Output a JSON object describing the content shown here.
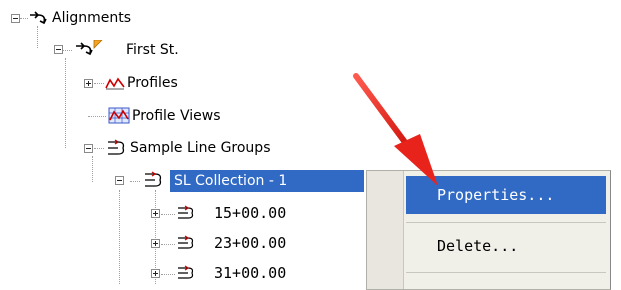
{
  "tree": {
    "items": [
      {
        "label": "Alignments",
        "icon": "alignment-icon"
      },
      {
        "label": "First St.",
        "icon": "alignment-flag-icon"
      },
      {
        "label": "Profiles",
        "icon": "profiles-icon"
      },
      {
        "label": "Profile Views",
        "icon": "profile-views-icon"
      },
      {
        "label": "Sample Line Groups",
        "icon": "sample-line-group-icon"
      },
      {
        "label": "SL Collection - 1",
        "icon": "sample-line-group-icon"
      },
      {
        "label": "15+00.00",
        "icon": "sample-line-icon"
      },
      {
        "label": "23+00.00",
        "icon": "sample-line-icon"
      },
      {
        "label": "31+00.00",
        "icon": "sample-line-icon"
      }
    ]
  },
  "context_menu": {
    "items": [
      {
        "label": "Properties..."
      },
      {
        "label": "Delete..."
      }
    ]
  },
  "colors": {
    "selection": "#316ac5",
    "arrow": "#e8231c",
    "menu_bg": "#f0efe8"
  }
}
